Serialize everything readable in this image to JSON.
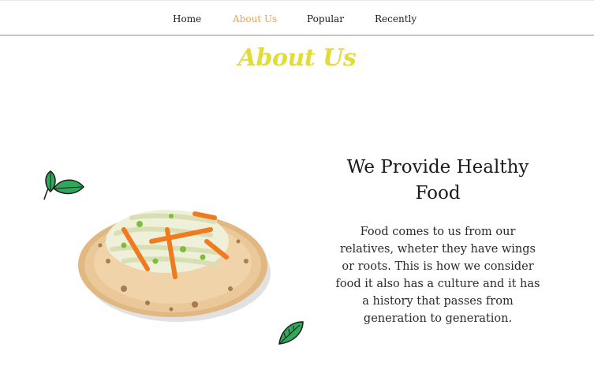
{
  "nav": {
    "items": [
      {
        "label": "Home",
        "active": false
      },
      {
        "label": "About Us",
        "active": true
      },
      {
        "label": "Popular",
        "active": false
      },
      {
        "label": "Recently",
        "active": false
      }
    ]
  },
  "about": {
    "title": "About Us",
    "heading": "We Provide Healthy Food",
    "body": "Food comes to us from our relatives, wheter they have wings or roots. This is how we consider food it also has a culture and it has a history that passes from generation to generation."
  },
  "colors": {
    "title": "#e1dc37",
    "nav_active": "#f0a04b",
    "leaf_green": "#2fa85c"
  },
  "icons": {
    "decor_top": "leaf-icon",
    "decor_bottom": "leaf-icon"
  }
}
